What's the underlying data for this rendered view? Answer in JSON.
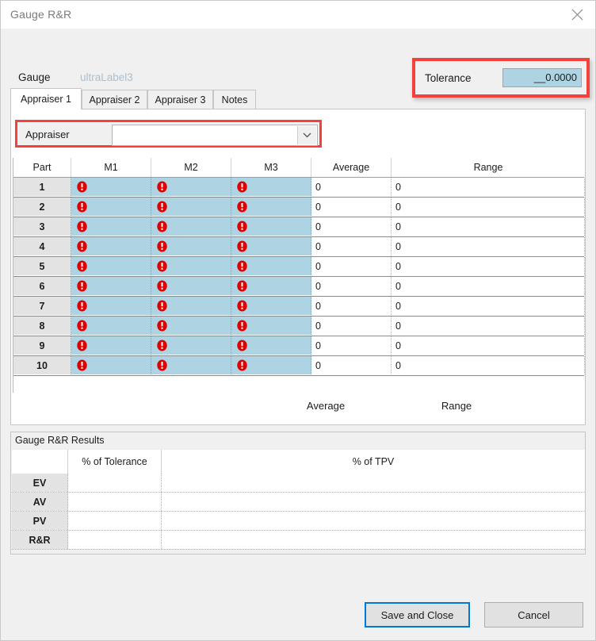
{
  "window": {
    "title": "Gauge R&R",
    "close_icon": "close-icon"
  },
  "header": {
    "gauge_label": "Gauge",
    "gauge_value": "ultraLabel3",
    "tolerance_label": "Tolerance",
    "tolerance_value": "__0.0000",
    "highlight_color": "#f5413c",
    "input_bg": "#aed4e3"
  },
  "tabs": [
    {
      "label": "Appraiser 1",
      "active": true
    },
    {
      "label": "Appraiser 2",
      "active": false
    },
    {
      "label": "Appraiser 3",
      "active": false
    },
    {
      "label": "Notes",
      "active": false
    }
  ],
  "appraiser": {
    "label": "Appraiser",
    "value": "",
    "placeholder": "",
    "dropdown_icon": "chevron-down-icon"
  },
  "grid": {
    "columns": [
      "Part",
      "M1",
      "M2",
      "M3",
      "Average",
      "Range"
    ],
    "error_icon": "error-icon",
    "rows": [
      {
        "part": "1",
        "m1": "error-icon",
        "m2": "error-icon",
        "m3": "error-icon",
        "average": "0",
        "range": "0"
      },
      {
        "part": "2",
        "m1": "error-icon",
        "m2": "error-icon",
        "m3": "error-icon",
        "average": "0",
        "range": "0"
      },
      {
        "part": "3",
        "m1": "error-icon",
        "m2": "error-icon",
        "m3": "error-icon",
        "average": "0",
        "range": "0"
      },
      {
        "part": "4",
        "m1": "error-icon",
        "m2": "error-icon",
        "m3": "error-icon",
        "average": "0",
        "range": "0"
      },
      {
        "part": "5",
        "m1": "error-icon",
        "m2": "error-icon",
        "m3": "error-icon",
        "average": "0",
        "range": "0"
      },
      {
        "part": "6",
        "m1": "error-icon",
        "m2": "error-icon",
        "m3": "error-icon",
        "average": "0",
        "range": "0"
      },
      {
        "part": "7",
        "m1": "error-icon",
        "m2": "error-icon",
        "m3": "error-icon",
        "average": "0",
        "range": "0"
      },
      {
        "part": "8",
        "m1": "error-icon",
        "m2": "error-icon",
        "m3": "error-icon",
        "average": "0",
        "range": "0"
      },
      {
        "part": "9",
        "m1": "error-icon",
        "m2": "error-icon",
        "m3": "error-icon",
        "average": "0",
        "range": "0"
      },
      {
        "part": "10",
        "m1": "error-icon",
        "m2": "error-icon",
        "m3": "error-icon",
        "average": "0",
        "range": "0"
      }
    ],
    "cell_bg": "#aed4e3",
    "header_bg": "#e3e3e3"
  },
  "summary": {
    "average_label": "Average",
    "range_label": "Range",
    "average_value": "",
    "range_value": ""
  },
  "results": {
    "title": "Gauge R&R Results",
    "columns": [
      "",
      "% of Tolerance",
      "% of TPV"
    ],
    "rows": [
      {
        "name": "EV",
        "tolerance": "",
        "tpv": ""
      },
      {
        "name": "AV",
        "tolerance": "",
        "tpv": ""
      },
      {
        "name": "PV",
        "tolerance": "",
        "tpv": ""
      },
      {
        "name": "R&R",
        "tolerance": "",
        "tpv": ""
      }
    ]
  },
  "footer": {
    "save_label": "Save and Close",
    "cancel_label": "Cancel",
    "default_button_color": "#0078d7"
  }
}
